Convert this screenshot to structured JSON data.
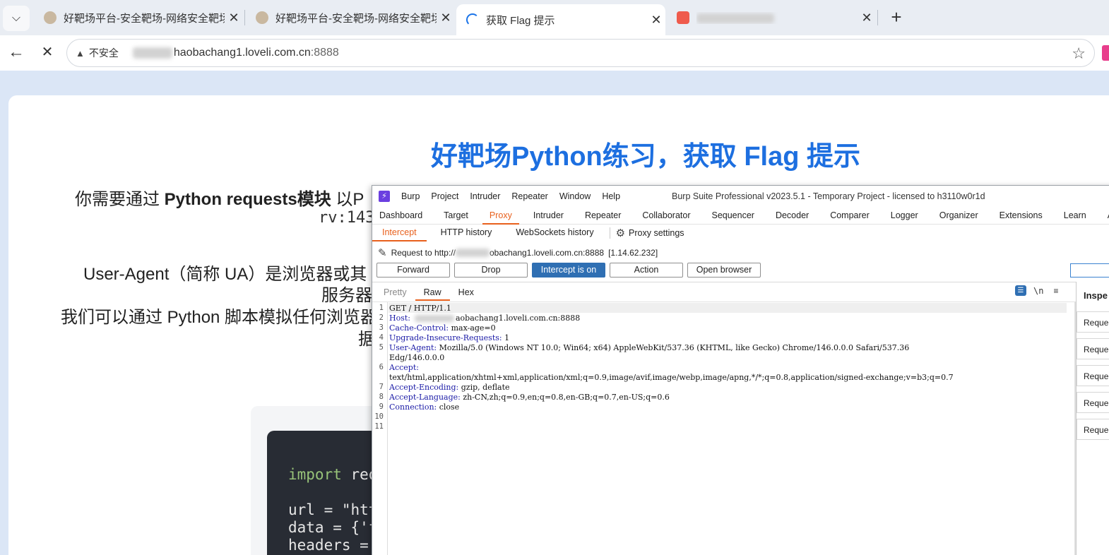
{
  "browser": {
    "tabs": [
      {
        "title": "好靶场平台-安全靶场-网络安全靶场",
        "close": "✕"
      },
      {
        "title": "好靶场平台-安全靶场-网络安全靶场",
        "close": "✕"
      },
      {
        "title": "获取 Flag 提示",
        "close": "✕"
      },
      {
        "title": "",
        "close": "✕"
      }
    ],
    "new_tab": "+",
    "tab_menu": "⌵",
    "back": "←",
    "stop": "✕",
    "address": {
      "warning_icon": "▲",
      "insecure_label": "不安全",
      "url_visible": "haobachang1.loveli.com.cn",
      "port": ":8888"
    },
    "star": "☆"
  },
  "page": {
    "title": "好靶场Python练习，获取 Flag 提示",
    "line1_a": "你需要通过 ",
    "line1_b": "Python requests模块",
    "line1_c": " 以P",
    "line1_mono": "rv:143.",
    "line2": "User-Agent（简称 UA）是浏览器或其",
    "line3": "服务器",
    "line4": "我们可以通过 Python 脚本模拟任何浏览器",
    "line5": "据",
    "code": {
      "l1_kw": "import",
      "l1_rest": " requ",
      "l2": "url = \"http",
      "l3": "data = {'fl",
      "l4": "headers = {"
    }
  },
  "burp": {
    "logo": "⚡",
    "menu": [
      "Burp",
      "Project",
      "Intruder",
      "Repeater",
      "Window",
      "Help"
    ],
    "window_title": "Burp Suite Professional v2023.5.1 - Temporary Project - licensed to h3110w0r1d",
    "tabs": [
      "Dashboard",
      "Target",
      "Proxy",
      "Intruder",
      "Repeater",
      "Collaborator",
      "Sequencer",
      "Decoder",
      "Comparer",
      "Logger",
      "Organizer",
      "Extensions",
      "Learn",
      "API"
    ],
    "active_tab": "Proxy",
    "subtabs": [
      "Intercept",
      "HTTP history",
      "WebSockets history"
    ],
    "proxy_settings": "Proxy settings",
    "request_to_prefix": "Request to http://",
    "request_to_host": "obachang1.loveli.com.cn:8888",
    "request_to_ip": "[1.14.62.232]",
    "buttons": [
      "Forward",
      "Drop",
      "Intercept is on",
      "Action",
      "Open browser"
    ],
    "view_tabs": [
      "Pretty",
      "Raw",
      "Hex"
    ],
    "active_view": "Raw",
    "newline_toggle": "\\n",
    "menu_icon": "≡",
    "wrap_icon": "☰",
    "inspector_title": "Inspe",
    "inspector_items": [
      "Reque",
      "Reque",
      "Reque",
      "Reque",
      "Reque"
    ],
    "request_lines": [
      {
        "n": "1",
        "key": "",
        "val": "GET / HTTP/1.1"
      },
      {
        "n": "2",
        "key": "Host:",
        "val": "aobachang1.loveli.com.cn:8888"
      },
      {
        "n": "3",
        "key": "Cache-Control:",
        "val": " max-age=0"
      },
      {
        "n": "4",
        "key": "Upgrade-Insecure-Requests:",
        "val": " 1"
      },
      {
        "n": "5",
        "key": "User-Agent:",
        "val": " Mozilla/5.0 (Windows NT 10.0; Win64; x64) AppleWebKit/537.36 (KHTML, like Gecko) Chrome/146.0.0.0 Safari/537.36"
      },
      {
        "n": "",
        "key": "",
        "val": "Edg/146.0.0.0"
      },
      {
        "n": "6",
        "key": "Accept:",
        "val": ""
      },
      {
        "n": "",
        "key": "",
        "val": "text/html,application/xhtml+xml,application/xml;q=0.9,image/avif,image/webp,image/apng,*/*;q=0.8,application/signed-exchange;v=b3;q=0.7"
      },
      {
        "n": "7",
        "key": "Accept-Encoding:",
        "val": " gzip, deflate"
      },
      {
        "n": "8",
        "key": "Accept-Language:",
        "val": " zh-CN,zh;q=0.9,en;q=0.8,en-GB;q=0.7,en-US;q=0.6"
      },
      {
        "n": "9",
        "key": "Connection:",
        "val": " close"
      },
      {
        "n": "10",
        "key": "",
        "val": ""
      },
      {
        "n": "11",
        "key": "",
        "val": ""
      }
    ]
  },
  "colors": {
    "page_title": "#1d6fe0",
    "burp_accent": "#e8601c",
    "intercept_on": "#2f6fb3"
  }
}
